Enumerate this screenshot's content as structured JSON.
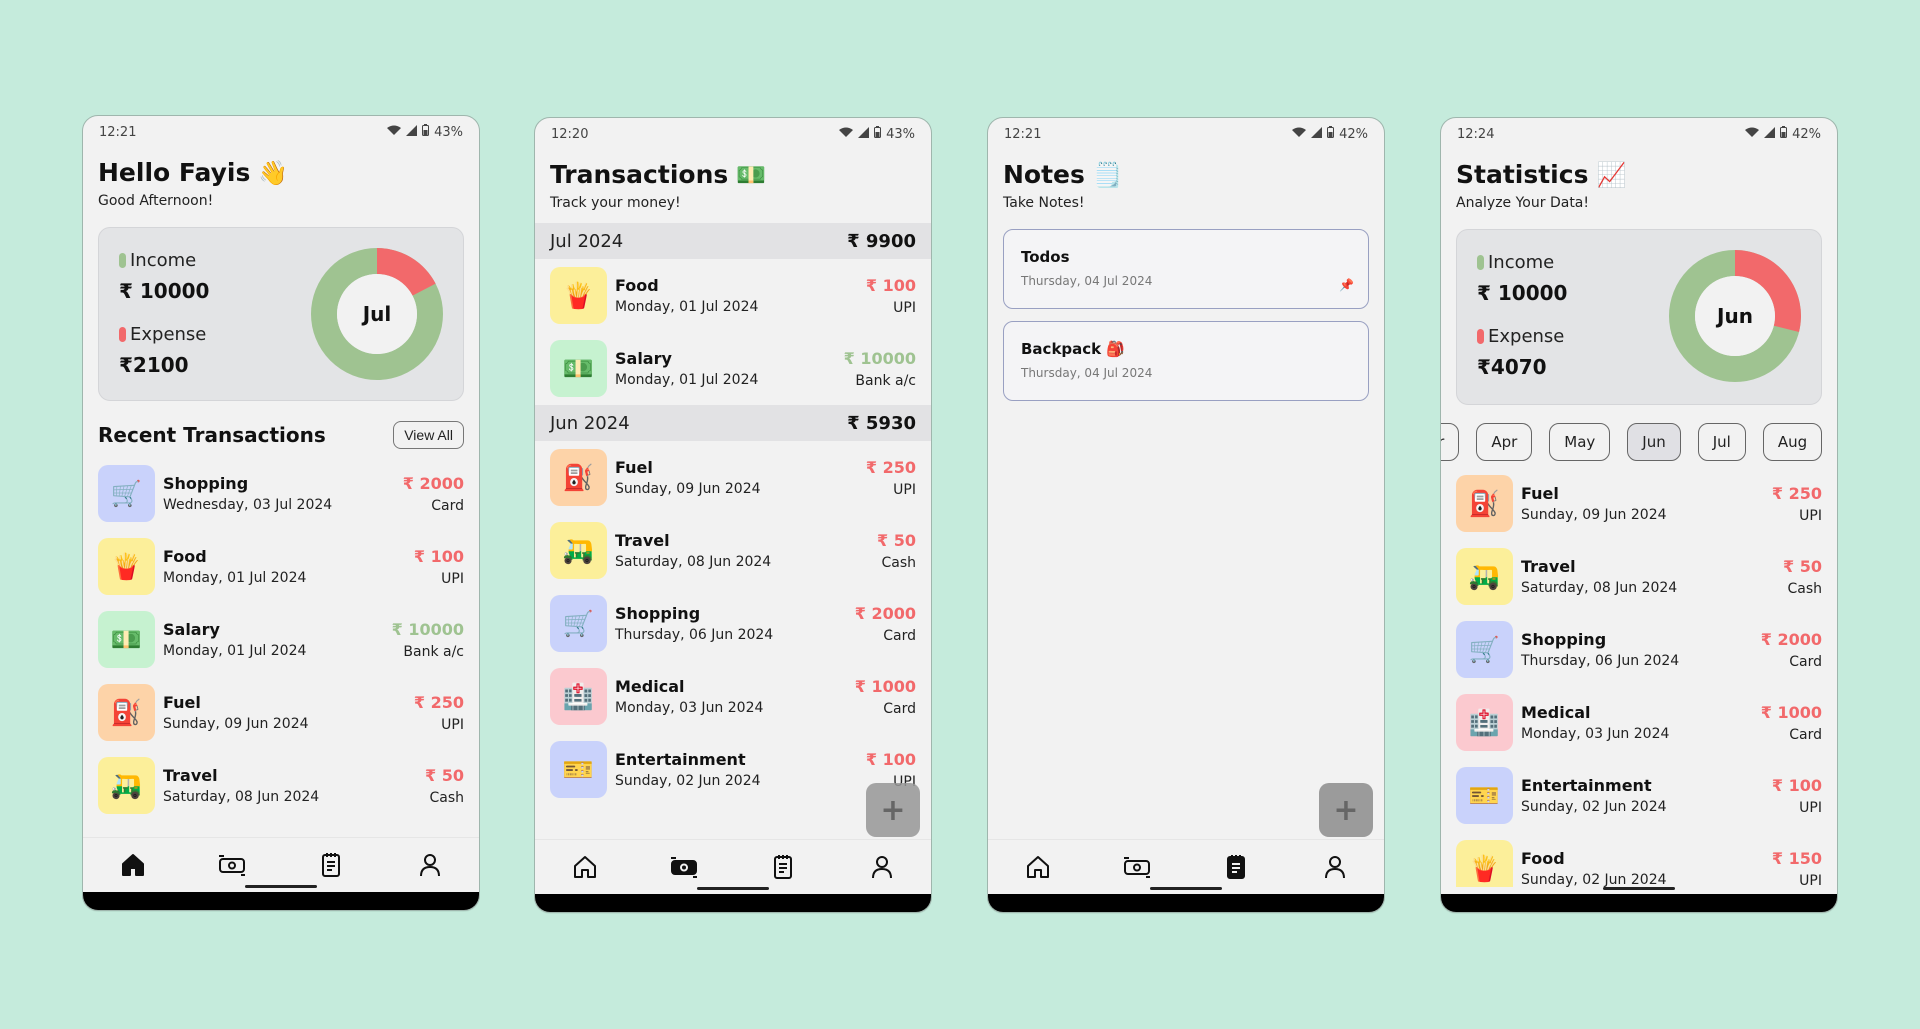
{
  "colors": {
    "income": "#9fc391",
    "expense": "#f2696b",
    "background": "#c5ebdc"
  },
  "screens": {
    "home": {
      "status": {
        "time": "12:21",
        "battery": "43%"
      },
      "title": "Hello Fayis",
      "title_emoji": "👋",
      "subtitle": "Good Afternoon!",
      "summary": {
        "income_label": "Income",
        "income_value": "₹ 10000",
        "expense_label": "Expense",
        "expense_value": "₹2100",
        "month": "Jul",
        "expense_fraction": 0.174
      },
      "recent_title": "Recent Transactions",
      "view_all": "View All",
      "transactions": [
        {
          "icon": "🛒",
          "icon_name": "shopping-cart-icon",
          "bg": "#c9d2fb",
          "name": "Shopping",
          "date": "Wednesday, 03 Jul 2024",
          "amount": "₹ 2000",
          "method": "Card",
          "kind": "expense"
        },
        {
          "icon": "🍟",
          "icon_name": "fries-icon",
          "bg": "#fcef9a",
          "name": "Food",
          "date": "Monday, 01 Jul 2024",
          "amount": "₹ 100",
          "method": "UPI",
          "kind": "expense"
        },
        {
          "icon": "💵",
          "icon_name": "cash-icon",
          "bg": "#c6f2d0",
          "name": "Salary",
          "date": "Monday, 01 Jul 2024",
          "amount": "₹ 10000",
          "method": "Bank a/c",
          "kind": "income"
        },
        {
          "icon": "⛽",
          "icon_name": "fuel-pump-icon",
          "bg": "#fdd3a8",
          "name": "Fuel",
          "date": "Sunday, 09 Jun 2024",
          "amount": "₹ 250",
          "method": "UPI",
          "kind": "expense"
        },
        {
          "icon": "🛺",
          "icon_name": "auto-rickshaw-icon",
          "bg": "#fcef9a",
          "name": "Travel",
          "date": "Saturday, 08 Jun 2024",
          "amount": "₹ 50",
          "method": "Cash",
          "kind": "expense"
        }
      ]
    },
    "transactions": {
      "status": {
        "time": "12:20",
        "battery": "43%"
      },
      "title": "Transactions",
      "title_emoji": "💵",
      "subtitle": "Track your money!",
      "groups": [
        {
          "month": "Jul 2024",
          "total": "₹ 9900",
          "items": [
            {
              "icon": "🍟",
              "icon_name": "fries-icon",
              "bg": "#fcef9a",
              "name": "Food",
              "date": "Monday, 01 Jul 2024",
              "amount": "₹ 100",
              "method": "UPI",
              "kind": "expense"
            },
            {
              "icon": "💵",
              "icon_name": "cash-icon",
              "bg": "#c6f2d0",
              "name": "Salary",
              "date": "Monday, 01 Jul 2024",
              "amount": "₹ 10000",
              "method": "Bank a/c",
              "kind": "income"
            }
          ]
        },
        {
          "month": "Jun 2024",
          "total": "₹ 5930",
          "items": [
            {
              "icon": "⛽",
              "icon_name": "fuel-pump-icon",
              "bg": "#fdd3a8",
              "name": "Fuel",
              "date": "Sunday, 09 Jun 2024",
              "amount": "₹ 250",
              "method": "UPI",
              "kind": "expense"
            },
            {
              "icon": "🛺",
              "icon_name": "auto-rickshaw-icon",
              "bg": "#fcef9a",
              "name": "Travel",
              "date": "Saturday, 08 Jun 2024",
              "amount": "₹ 50",
              "method": "Cash",
              "kind": "expense"
            },
            {
              "icon": "🛒",
              "icon_name": "shopping-cart-icon",
              "bg": "#c9d2fb",
              "name": "Shopping",
              "date": "Thursday, 06 Jun 2024",
              "amount": "₹ 2000",
              "method": "Card",
              "kind": "expense"
            },
            {
              "icon": "🏥",
              "icon_name": "hospital-icon",
              "bg": "#fbc9cf",
              "name": "Medical",
              "date": "Monday, 03 Jun 2024",
              "amount": "₹ 1000",
              "method": "Card",
              "kind": "expense"
            },
            {
              "icon": "🎫",
              "icon_name": "ticket-icon",
              "bg": "#c9d2fb",
              "name": "Entertainment",
              "date": "Sunday, 02 Jun 2024",
              "amount": "₹ 100",
              "method": "UPI",
              "kind": "expense"
            }
          ]
        }
      ]
    },
    "notes": {
      "status": {
        "time": "12:21",
        "battery": "42%"
      },
      "title": "Notes",
      "title_emoji": "🗒️",
      "subtitle": "Take Notes!",
      "notes": [
        {
          "title": "Todos",
          "date": "Thursday, 04 Jul 2024",
          "pinned": true
        },
        {
          "title": "Backpack 🎒",
          "date": "Thursday, 04 Jul 2024",
          "pinned": false
        }
      ]
    },
    "statistics": {
      "status": {
        "time": "12:24",
        "battery": "42%"
      },
      "title": "Statistics",
      "title_emoji": "📈",
      "subtitle": "Analyze Your Data!",
      "summary": {
        "income_label": "Income",
        "income_value": "₹ 10000",
        "expense_label": "Expense",
        "expense_value": "₹4070",
        "month": "Jun",
        "expense_fraction": 0.289
      },
      "months": [
        "Mar",
        "Apr",
        "May",
        "Jun",
        "Jul",
        "Aug"
      ],
      "selected_month": "Jun",
      "transactions": [
        {
          "icon": "⛽",
          "icon_name": "fuel-pump-icon",
          "bg": "#fdd3a8",
          "name": "Fuel",
          "date": "Sunday, 09 Jun 2024",
          "amount": "₹ 250",
          "method": "UPI",
          "kind": "expense"
        },
        {
          "icon": "🛺",
          "icon_name": "auto-rickshaw-icon",
          "bg": "#fcef9a",
          "name": "Travel",
          "date": "Saturday, 08 Jun 2024",
          "amount": "₹ 50",
          "method": "Cash",
          "kind": "expense"
        },
        {
          "icon": "🛒",
          "icon_name": "shopping-cart-icon",
          "bg": "#c9d2fb",
          "name": "Shopping",
          "date": "Thursday, 06 Jun 2024",
          "amount": "₹ 2000",
          "method": "Card",
          "kind": "expense"
        },
        {
          "icon": "🏥",
          "icon_name": "hospital-icon",
          "bg": "#fbc9cf",
          "name": "Medical",
          "date": "Monday, 03 Jun 2024",
          "amount": "₹ 1000",
          "method": "Card",
          "kind": "expense"
        },
        {
          "icon": "🎫",
          "icon_name": "ticket-icon",
          "bg": "#c9d2fb",
          "name": "Entertainment",
          "date": "Sunday, 02 Jun 2024",
          "amount": "₹ 100",
          "method": "UPI",
          "kind": "expense"
        },
        {
          "icon": "🍟",
          "icon_name": "fries-icon",
          "bg": "#fcef9a",
          "name": "Food",
          "date": "Sunday, 02 Jun 2024",
          "amount": "₹ 150",
          "method": "UPI",
          "kind": "expense"
        }
      ]
    }
  },
  "fab_label": "+",
  "nav": [
    "home",
    "transactions",
    "notes",
    "profile"
  ]
}
